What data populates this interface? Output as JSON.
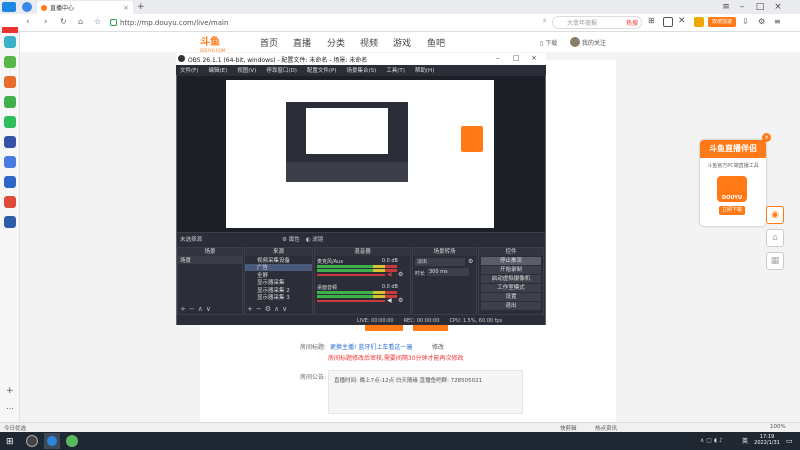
{
  "browser": {
    "tab_title": "直播中心",
    "new_tab": "+",
    "url": "http://mp.douyu.com/live/main",
    "search_placeholder": "大变年夜报",
    "search_hot": "热搜",
    "badge": "双倍加速"
  },
  "site": {
    "logo": "斗鱼",
    "logo_sub": "DOUYU.COM",
    "nav": [
      "首页",
      "直播",
      "分类",
      "视频",
      "游戏",
      "鱼吧"
    ],
    "download": "下载",
    "user": "我的关注"
  },
  "obs": {
    "title": "OBS 26.1.1 (64-bit, windows) - 配置文件: 未命名 - 场景: 未命名",
    "menu": [
      "文件(F)",
      "编辑(E)",
      "视图(V)",
      "停靠窗口(D)",
      "配置文件(P)",
      "场景集合(S)",
      "工具(T)",
      "帮助(H)"
    ],
    "source_none": "未选择源",
    "props": "属性",
    "filters": "滤镜",
    "docks": {
      "scenes": "场景",
      "sources": "来源",
      "mixer": "混音器",
      "transitions": "场景转场",
      "controls": "控件"
    },
    "scenes": [
      "场景"
    ],
    "sources": [
      "视频采集设备",
      "广告",
      "全屏",
      "显示器采集",
      "显示器采集 2",
      "显示器采集 3"
    ],
    "mixer_channels": [
      {
        "name": "麦克风/Aux",
        "db": "0.0 dB"
      },
      {
        "name": "桌面音频",
        "db": "0.0 dB"
      }
    ],
    "transition": "淡出",
    "duration_label": "时长",
    "duration": "300 ms",
    "controls": [
      "停止推流",
      "开始录制",
      "启动虚拟摄像机",
      "工作室模式",
      "设置",
      "退出"
    ],
    "status": {
      "live": "LIVE: 00:00:00",
      "rec": "REC: 00:00:00",
      "cpu": "CPU: 1.5%, 60.00 fps",
      "kbps": "kb/s: 2 kb/s",
      "fps": "0.0%"
    }
  },
  "form": {
    "label1": "房间标题:",
    "title_link": "更换主播! 蓝牙们上车看这一遍",
    "title_btn": "修改",
    "title_tip": "房间标题修改后审核,需要间隔30分钟才能再次修改",
    "label2": "房间公告:",
    "notice": "直播时间: 晚上7点-12点 白天随缘 直播鱼吧群: 728505021"
  },
  "ad": {
    "title": "斗鱼直播伴侣",
    "desc": "斗鱼官方PC端直播工具",
    "brand": "DOUYU",
    "button": "立即下载"
  },
  "statusbar": {
    "left": "今日优选",
    "mid1": "快剪辑",
    "mid2": "热点资讯",
    "zoom": "100%"
  },
  "taskbar": {
    "time": "17:19",
    "date": "2022/1/31",
    "lang": "英"
  },
  "colors": {
    "accent": "#ff7a17",
    "obs_bg": "#2b2e38",
    "taskbar": "#1f2733"
  }
}
